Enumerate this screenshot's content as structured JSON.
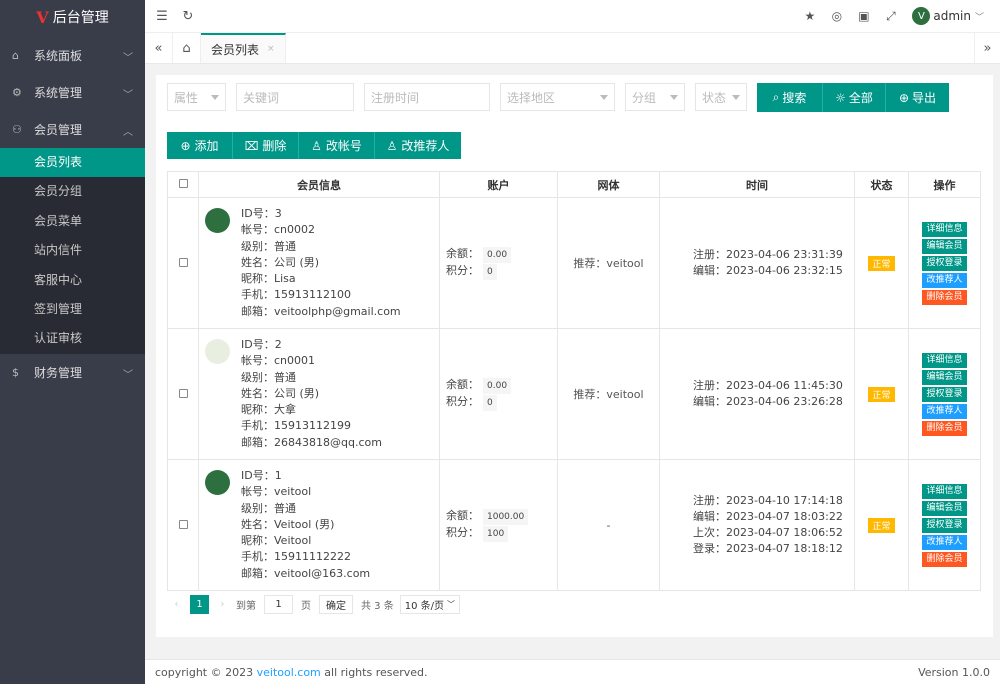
{
  "app": {
    "logo_mark": "V",
    "title": "后台管理"
  },
  "sidebar": {
    "items": [
      {
        "label": "系统面板",
        "icon": "home-icon"
      },
      {
        "label": "系统管理",
        "icon": "gear-icon"
      },
      {
        "label": "会员管理",
        "icon": "user-icon",
        "expanded": true
      },
      {
        "label": "财务管理",
        "icon": "money-icon"
      }
    ],
    "sub_items": [
      "会员列表",
      "会员分组",
      "会员菜单",
      "站内信件",
      "客服中心",
      "签到管理",
      "认证审核"
    ],
    "active_sub": "会员列表"
  },
  "header": {
    "user": "admin"
  },
  "tabs": {
    "active": "会员列表",
    "close": "×"
  },
  "filters": {
    "attr": "属性",
    "keyword": "关键词",
    "reg_time": "注册时间",
    "region": "选择地区",
    "group": "分组",
    "status": "状态",
    "search": "搜索",
    "all": "全部",
    "export": "导出"
  },
  "actions": {
    "add": "添加",
    "delete": "删除",
    "change_account": "改帐号",
    "change_referrer": "改推荐人"
  },
  "table": {
    "headers": [
      "会员信息",
      "账户",
      "网体",
      "时间",
      "状态",
      "操作"
    ],
    "labels": {
      "id": "ID号：",
      "account": "帐号：",
      "level": "级别：",
      "name": "姓名：",
      "nick": "昵称：",
      "phone": "手机：",
      "email": "邮箱：",
      "balance": "余额：",
      "points": "积分："
    },
    "ops": [
      "详细信息",
      "编辑会员",
      "授权登录",
      "改推荐人",
      "删除会员"
    ],
    "rows": [
      {
        "id": "3",
        "account": "cn0002",
        "level": "普通",
        "name": "公司 (男)",
        "nick": "Lisa",
        "phone": "15913112100",
        "email": "veitoolphp@gmail.com",
        "balance": "0.00",
        "points": "0",
        "net": "推荐：veitool",
        "times": [
          "注册：2023-04-06 23:31:39",
          "编辑：2023-04-06 23:32:15"
        ],
        "status": "正常"
      },
      {
        "id": "2",
        "account": "cn0001",
        "level": "普通",
        "name": "公司 (男)",
        "nick": "大拿",
        "phone": "15913112199",
        "email": "26843818@qq.com",
        "balance": "0.00",
        "points": "0",
        "net": "推荐：veitool",
        "times": [
          "注册：2023-04-06 11:45:30",
          "编辑：2023-04-06 23:26:28"
        ],
        "status": "正常"
      },
      {
        "id": "1",
        "account": "veitool",
        "level": "普通",
        "name": "Veitool (男)",
        "nick": "Veitool",
        "phone": "15911112222",
        "email": "veitool@163.com",
        "balance": "1000.00",
        "points": "100",
        "net": "-",
        "times": [
          "注册：2023-04-10 17:14:18",
          "编辑：2023-04-07 18:03:22",
          "上次：2023-04-07 18:06:52",
          "登录：2023-04-07 18:18:12"
        ],
        "status": "正常"
      }
    ]
  },
  "pager": {
    "current": "1",
    "goto": "到第",
    "page_input": "1",
    "page_unit": "页",
    "ok": "确定",
    "total": "共 3 条",
    "per_page": "10 条/页"
  },
  "footer": {
    "copyright": "copyright © 2023",
    "link": "veitool.com",
    "rights": "all rights reserved.",
    "version": "Version 1.0.0"
  },
  "colors": {
    "accent": "#009688",
    "sidebar": "#393d49",
    "blue": "#1e9fff",
    "red": "#ff5722",
    "warn": "#ffb800"
  }
}
